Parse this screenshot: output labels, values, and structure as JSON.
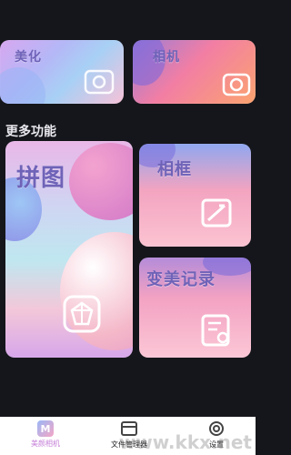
{
  "cards": {
    "beautify": "美化",
    "camera": "相机",
    "collage": "拼图",
    "frame": "相框",
    "record": "变美记录"
  },
  "section_title": "更多功能",
  "bottom_nav": {
    "items": [
      {
        "label": "美颜相机",
        "icon": "m-logo-icon",
        "active": true
      },
      {
        "label": "文件管理器",
        "icon": "folder-icon",
        "active": false
      },
      {
        "label": "设置",
        "icon": "settings-icon",
        "active": false
      }
    ]
  },
  "watermark": "www.kkx.net",
  "colors": {
    "background": "#15161b",
    "label": "#6f63b8",
    "active_nav": "#c680d8"
  }
}
